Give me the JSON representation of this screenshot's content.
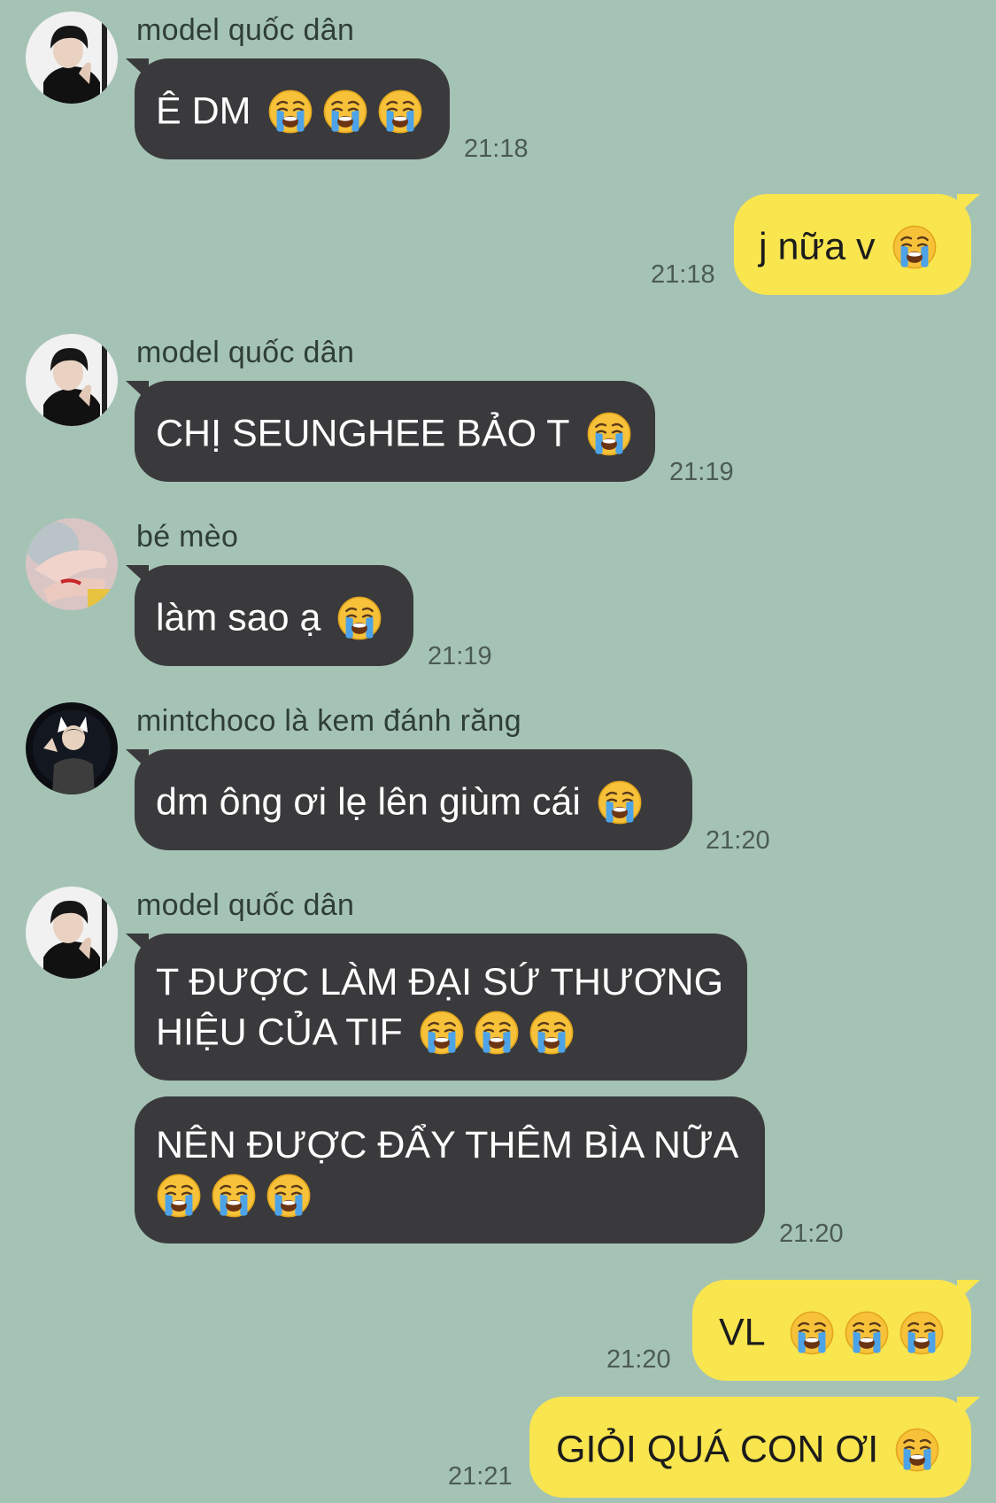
{
  "messages": [
    {
      "sender": "model quốc dân",
      "text": "Ê DM",
      "emoji_count": 3,
      "time": "21:18",
      "avatar": "portrait-boy-avatar"
    },
    {
      "text": "j nữa v",
      "emoji_count": 1,
      "time": "21:18",
      "outgoing": true
    },
    {
      "sender": "model quốc dân",
      "text": "CHỊ SEUNGHEE BẢO T",
      "emoji_count": 1,
      "time": "21:19",
      "avatar": "portrait-boy-avatar"
    },
    {
      "sender": "bé mèo",
      "text": "làm sao ạ",
      "emoji_count": 1,
      "time": "21:19",
      "avatar": "hand-photo-avatar"
    },
    {
      "sender": "mintchoco là kem đánh răng",
      "text": "dm ông ơi lẹ lên giùm cái",
      "emoji_count": 1,
      "time": "21:20",
      "avatar": "cat-ears-avatar"
    },
    {
      "sender": "model quốc dân",
      "text_line1": "T ĐƯỢC LÀM ĐẠI SỨ THƯƠNG",
      "text_line2": "HIỆU CỦA TIF",
      "emoji_count": 3,
      "avatar": "portrait-boy-avatar"
    },
    {
      "text_line1": "NÊN ĐƯỢC ĐẨY THÊM BÌA NỮA",
      "emoji_count": 3,
      "time": "21:20"
    },
    {
      "text": "VL",
      "emoji_count": 3,
      "time": "21:20",
      "outgoing": true
    },
    {
      "text": "GIỎI QUÁ CON ƠI",
      "emoji_count": 1,
      "time": "21:21",
      "outgoing": true
    }
  ],
  "icons": {
    "emoji": "loudly-crying-face-emoji"
  },
  "colors": {
    "background": "#a5c3b5",
    "incoming_bubble": "#3a3a3c",
    "outgoing_bubble": "#f9e54e"
  }
}
